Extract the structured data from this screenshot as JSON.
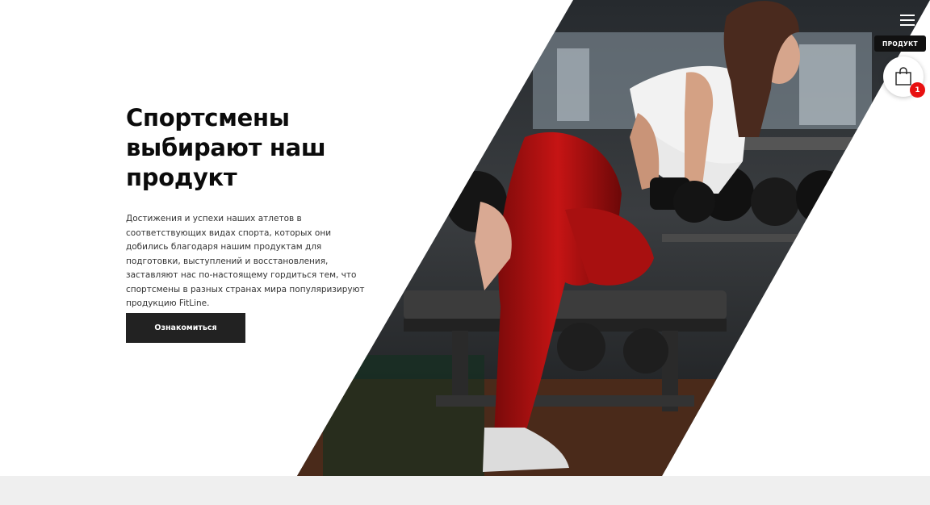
{
  "hero": {
    "title": "Спортсмены выбирают наш продукт",
    "text": "Достижения и успехи наших атлетов в соответствующих видах спорта, которых они добились благодаря нашим продуктам для подготовки, выступлений и восстановления, заставляют нас по-настоящему гордиться тем, что спортсмены в разных странах мира популяризируют продукцию FitLine.",
    "cta_label": "Ознакомиться",
    "image": "woman-training-with-dumbbell-in-gym-photo"
  },
  "header": {
    "menu_icon": "hamburger-menu-icon",
    "product_badge": "ПРОДУКТ",
    "cart_icon": "shopping-bag-icon",
    "cart_count": "1"
  },
  "colors": {
    "accent": "#e81010",
    "dark": "#222222",
    "footer_band": "#efefef"
  }
}
